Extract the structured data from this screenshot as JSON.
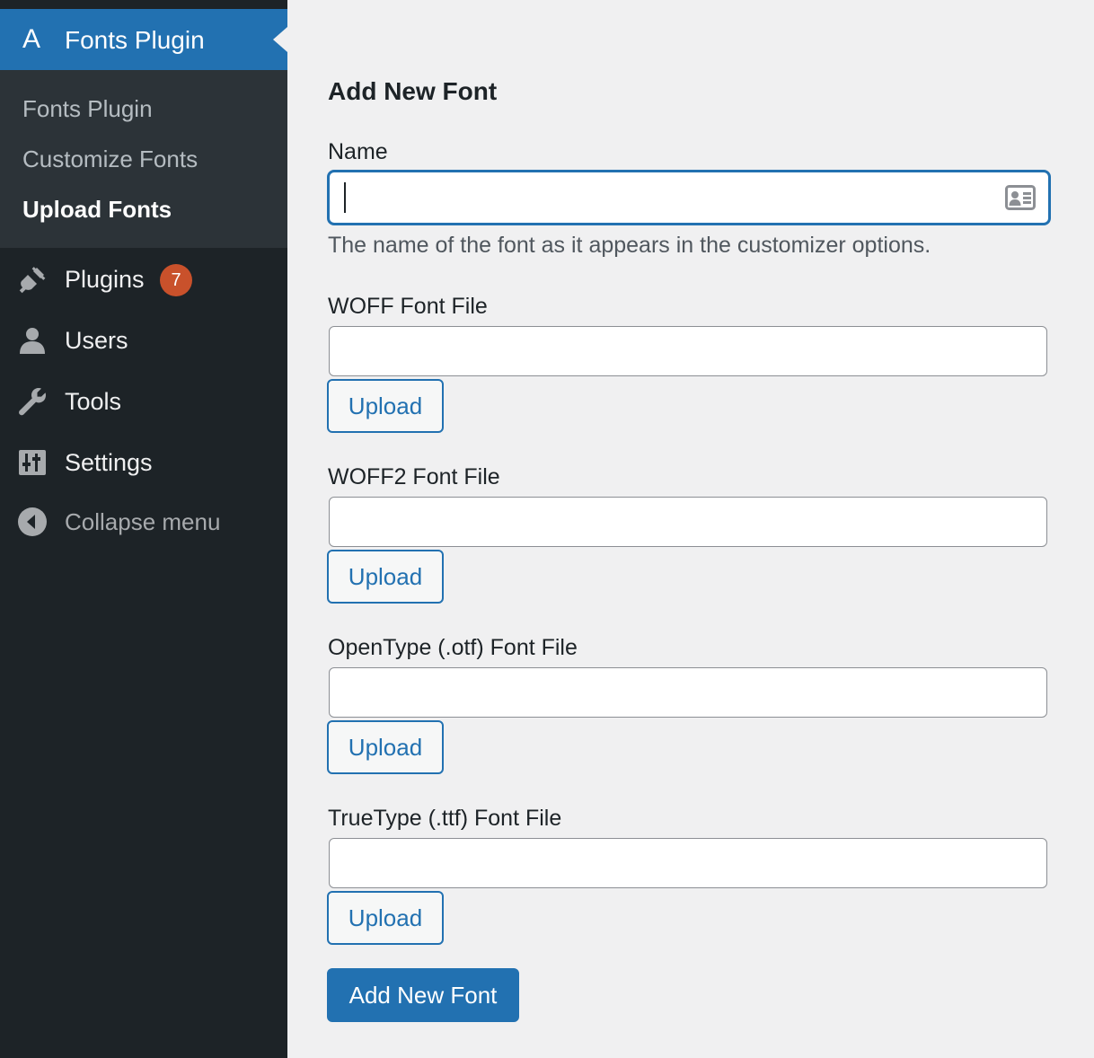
{
  "colors": {
    "sidebar_bg": "#1d2327",
    "submenu_bg": "#2c3338",
    "accent": "#2271b1",
    "badge": "#c9512b",
    "page_bg": "#f0f0f1"
  },
  "sidebar": {
    "current_menu": {
      "icon_glyph": "A",
      "icon": "fonts-plugin-logo-icon",
      "label": "Fonts Plugin"
    },
    "submenu": [
      {
        "label": "Fonts Plugin",
        "current": false
      },
      {
        "label": "Customize Fonts",
        "current": false
      },
      {
        "label": "Upload Fonts",
        "current": true
      }
    ],
    "items": [
      {
        "label": "Plugins",
        "icon": "plugins-icon",
        "badge": "7"
      },
      {
        "label": "Users",
        "icon": "users-icon"
      },
      {
        "label": "Tools",
        "icon": "tools-icon"
      },
      {
        "label": "Settings",
        "icon": "settings-icon"
      }
    ],
    "collapse": {
      "label": "Collapse menu",
      "icon": "collapse-icon"
    }
  },
  "form": {
    "title": "Add New Font",
    "name": {
      "label": "Name",
      "value": "",
      "description": "The name of the font as it appears in the customizer options."
    },
    "files": [
      {
        "label": "WOFF Font File",
        "value": "",
        "button": "Upload"
      },
      {
        "label": "WOFF2 Font File",
        "value": "",
        "button": "Upload"
      },
      {
        "label": "OpenType (.otf) Font File",
        "value": "",
        "button": "Upload"
      },
      {
        "label": "TrueType (.ttf) Font File",
        "value": "",
        "button": "Upload"
      }
    ],
    "submit_label": "Add New Font"
  }
}
